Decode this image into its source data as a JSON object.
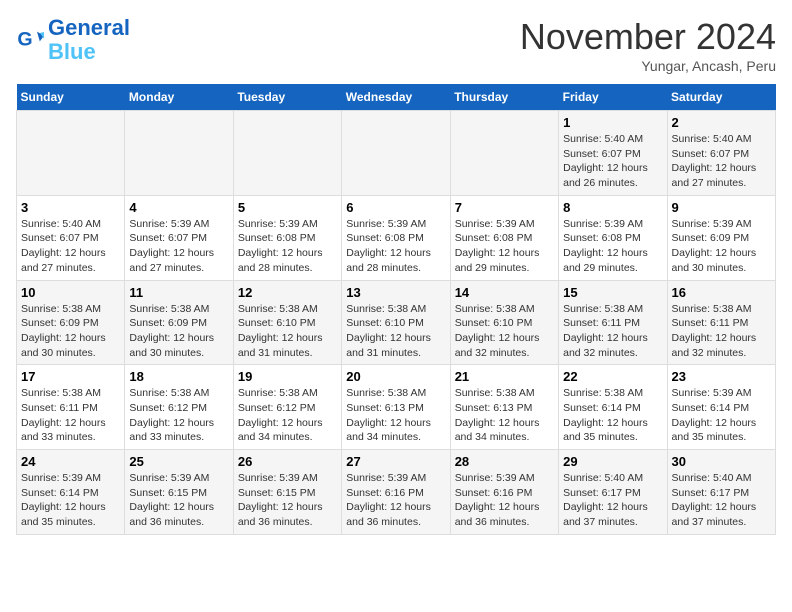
{
  "header": {
    "logo_line1": "General",
    "logo_line2": "Blue",
    "title": "November 2024",
    "location": "Yungar, Ancash, Peru"
  },
  "days_of_week": [
    "Sunday",
    "Monday",
    "Tuesday",
    "Wednesday",
    "Thursday",
    "Friday",
    "Saturday"
  ],
  "weeks": [
    {
      "cells": [
        {
          "day": null
        },
        {
          "day": null
        },
        {
          "day": null
        },
        {
          "day": null
        },
        {
          "day": null
        },
        {
          "day": "1",
          "sunrise": "5:40 AM",
          "sunset": "6:07 PM",
          "daylight": "12 hours and 26 minutes."
        },
        {
          "day": "2",
          "sunrise": "5:40 AM",
          "sunset": "6:07 PM",
          "daylight": "12 hours and 27 minutes."
        }
      ]
    },
    {
      "cells": [
        {
          "day": "3",
          "sunrise": "5:40 AM",
          "sunset": "6:07 PM",
          "daylight": "12 hours and 27 minutes."
        },
        {
          "day": "4",
          "sunrise": "5:39 AM",
          "sunset": "6:07 PM",
          "daylight": "12 hours and 27 minutes."
        },
        {
          "day": "5",
          "sunrise": "5:39 AM",
          "sunset": "6:08 PM",
          "daylight": "12 hours and 28 minutes."
        },
        {
          "day": "6",
          "sunrise": "5:39 AM",
          "sunset": "6:08 PM",
          "daylight": "12 hours and 28 minutes."
        },
        {
          "day": "7",
          "sunrise": "5:39 AM",
          "sunset": "6:08 PM",
          "daylight": "12 hours and 29 minutes."
        },
        {
          "day": "8",
          "sunrise": "5:39 AM",
          "sunset": "6:08 PM",
          "daylight": "12 hours and 29 minutes."
        },
        {
          "day": "9",
          "sunrise": "5:39 AM",
          "sunset": "6:09 PM",
          "daylight": "12 hours and 30 minutes."
        }
      ]
    },
    {
      "cells": [
        {
          "day": "10",
          "sunrise": "5:38 AM",
          "sunset": "6:09 PM",
          "daylight": "12 hours and 30 minutes."
        },
        {
          "day": "11",
          "sunrise": "5:38 AM",
          "sunset": "6:09 PM",
          "daylight": "12 hours and 30 minutes."
        },
        {
          "day": "12",
          "sunrise": "5:38 AM",
          "sunset": "6:10 PM",
          "daylight": "12 hours and 31 minutes."
        },
        {
          "day": "13",
          "sunrise": "5:38 AM",
          "sunset": "6:10 PM",
          "daylight": "12 hours and 31 minutes."
        },
        {
          "day": "14",
          "sunrise": "5:38 AM",
          "sunset": "6:10 PM",
          "daylight": "12 hours and 32 minutes."
        },
        {
          "day": "15",
          "sunrise": "5:38 AM",
          "sunset": "6:11 PM",
          "daylight": "12 hours and 32 minutes."
        },
        {
          "day": "16",
          "sunrise": "5:38 AM",
          "sunset": "6:11 PM",
          "daylight": "12 hours and 32 minutes."
        }
      ]
    },
    {
      "cells": [
        {
          "day": "17",
          "sunrise": "5:38 AM",
          "sunset": "6:11 PM",
          "daylight": "12 hours and 33 minutes."
        },
        {
          "day": "18",
          "sunrise": "5:38 AM",
          "sunset": "6:12 PM",
          "daylight": "12 hours and 33 minutes."
        },
        {
          "day": "19",
          "sunrise": "5:38 AM",
          "sunset": "6:12 PM",
          "daylight": "12 hours and 34 minutes."
        },
        {
          "day": "20",
          "sunrise": "5:38 AM",
          "sunset": "6:13 PM",
          "daylight": "12 hours and 34 minutes."
        },
        {
          "day": "21",
          "sunrise": "5:38 AM",
          "sunset": "6:13 PM",
          "daylight": "12 hours and 34 minutes."
        },
        {
          "day": "22",
          "sunrise": "5:38 AM",
          "sunset": "6:14 PM",
          "daylight": "12 hours and 35 minutes."
        },
        {
          "day": "23",
          "sunrise": "5:39 AM",
          "sunset": "6:14 PM",
          "daylight": "12 hours and 35 minutes."
        }
      ]
    },
    {
      "cells": [
        {
          "day": "24",
          "sunrise": "5:39 AM",
          "sunset": "6:14 PM",
          "daylight": "12 hours and 35 minutes."
        },
        {
          "day": "25",
          "sunrise": "5:39 AM",
          "sunset": "6:15 PM",
          "daylight": "12 hours and 36 minutes."
        },
        {
          "day": "26",
          "sunrise": "5:39 AM",
          "sunset": "6:15 PM",
          "daylight": "12 hours and 36 minutes."
        },
        {
          "day": "27",
          "sunrise": "5:39 AM",
          "sunset": "6:16 PM",
          "daylight": "12 hours and 36 minutes."
        },
        {
          "day": "28",
          "sunrise": "5:39 AM",
          "sunset": "6:16 PM",
          "daylight": "12 hours and 36 minutes."
        },
        {
          "day": "29",
          "sunrise": "5:40 AM",
          "sunset": "6:17 PM",
          "daylight": "12 hours and 37 minutes."
        },
        {
          "day": "30",
          "sunrise": "5:40 AM",
          "sunset": "6:17 PM",
          "daylight": "12 hours and 37 minutes."
        }
      ]
    }
  ]
}
